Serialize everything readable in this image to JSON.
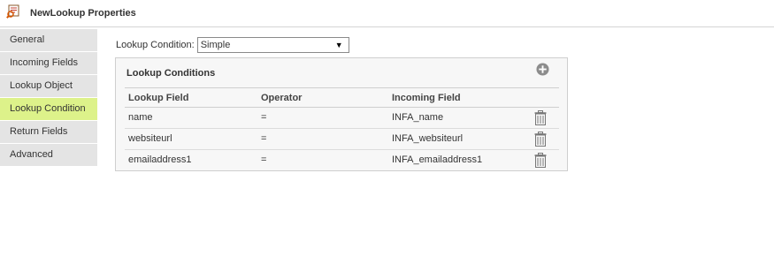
{
  "header": {
    "title": "NewLookup Properties",
    "icon": "lookup-properties-icon"
  },
  "sidebar": {
    "items": [
      {
        "label": "General",
        "active": false
      },
      {
        "label": "Incoming Fields",
        "active": false
      },
      {
        "label": "Lookup Object",
        "active": false
      },
      {
        "label": "Lookup Condition",
        "active": true
      },
      {
        "label": "Return Fields",
        "active": false
      },
      {
        "label": "Advanced",
        "active": false
      }
    ],
    "active_color": "#ddf28a"
  },
  "condition": {
    "label": "Lookup Condition:",
    "selected": "Simple"
  },
  "panel": {
    "title": "Lookup Conditions",
    "add_icon": "add-circle-icon",
    "columns": [
      "Lookup Field",
      "Operator",
      "Incoming Field"
    ],
    "rows": [
      {
        "lookup_field": "name",
        "operator": "=",
        "incoming_field": "INFA_name"
      },
      {
        "lookup_field": "websiteurl",
        "operator": "=",
        "incoming_field": "INFA_websiteurl"
      },
      {
        "lookup_field": "emailaddress1",
        "operator": "=",
        "incoming_field": "INFA_emailaddress1"
      }
    ],
    "delete_icon": "trash-icon"
  }
}
